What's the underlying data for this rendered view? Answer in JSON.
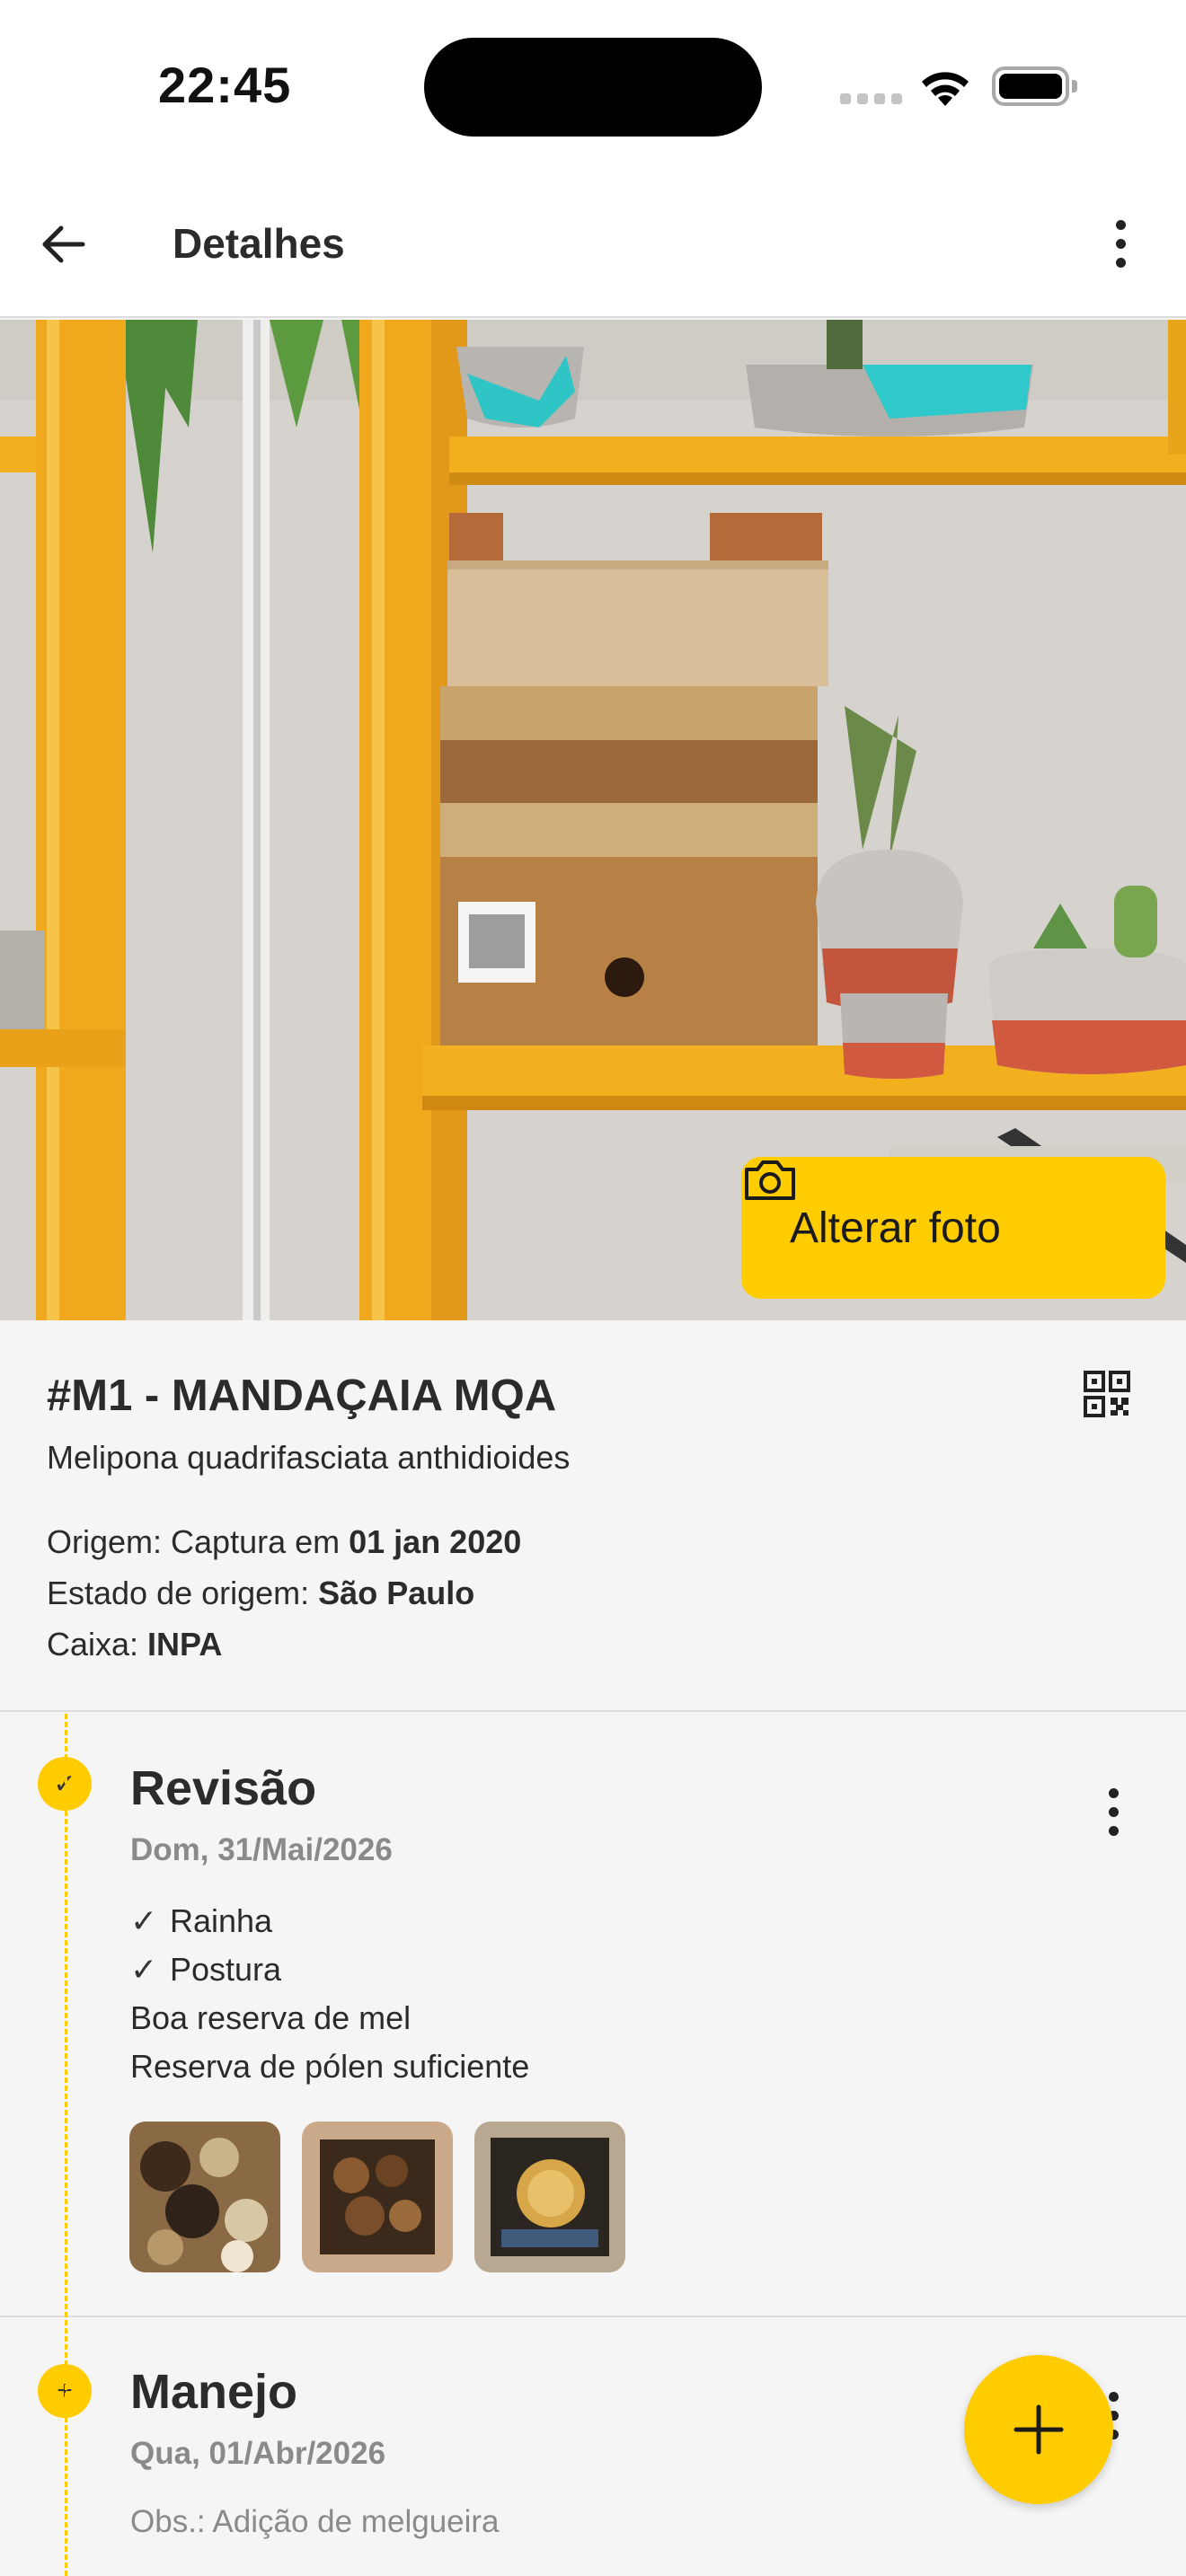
{
  "status_bar": {
    "time": "22:45",
    "icons": [
      "cellular-signal-icon",
      "wifi-icon",
      "battery-icon"
    ]
  },
  "app_bar": {
    "title": "Detalhes",
    "back_icon": "arrow-left-icon",
    "menu_icon": "more-vertical-icon"
  },
  "photo": {
    "change_label": "Alterar foto",
    "change_icon": "camera-icon"
  },
  "hive": {
    "title": "#M1 - MANDAÇAIA MQA",
    "species": "Melipona quadrifasciata anthidioides",
    "origin_label": "Origem: Captura em ",
    "origin_value": "01 jan 2020",
    "state_label": "Estado de origem: ",
    "state_value": "São Paulo",
    "box_label": "Caixa: ",
    "box_value": "INPA",
    "qr_icon": "qr-code-icon"
  },
  "timeline": [
    {
      "title": "Revisão",
      "date": "Dom, 31/Mai/2026",
      "status_icon": "check-icon",
      "checks": [
        "Rainha",
        "Postura"
      ],
      "notes": [
        "Boa reserva de mel",
        "Reserva de pólen suficiente"
      ],
      "photos": 3
    },
    {
      "title": "Manejo",
      "date": "Qua, 01/Abr/2026",
      "status_icon": "plus-icon",
      "obs": "Obs.: Adição de melgueira"
    }
  ],
  "fab": {
    "icon": "plus-icon"
  },
  "colors": {
    "accent": "#ffcc00",
    "text": "#2b2b2b",
    "muted": "#8a8a8a",
    "background": "#f5f5f5"
  }
}
